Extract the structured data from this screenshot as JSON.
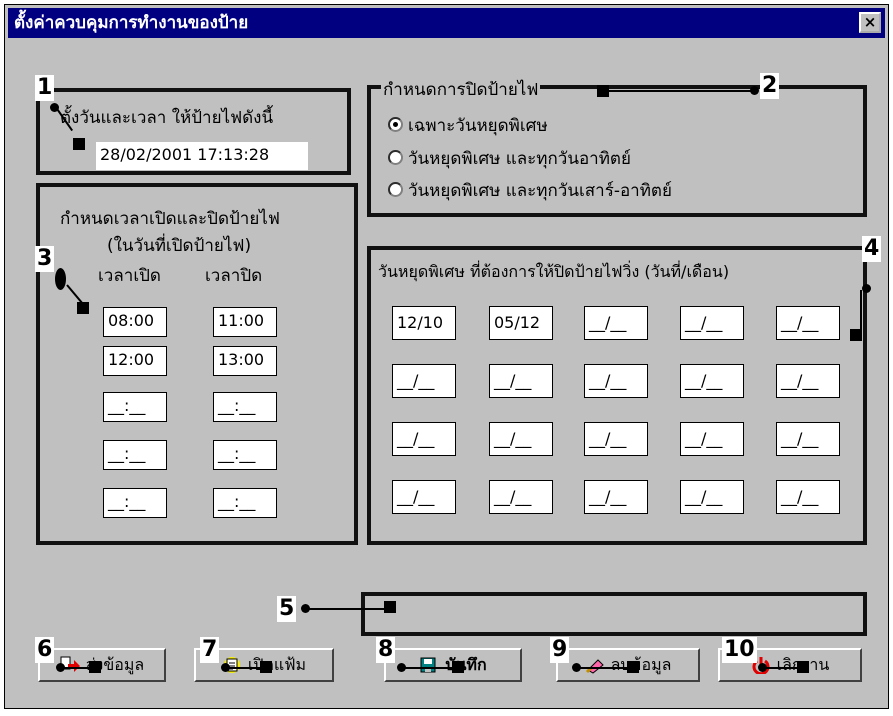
{
  "window": {
    "title": "ตั้งค่าควบคุมการทำงานของป้าย",
    "close_glyph": "×"
  },
  "datetime_group": {
    "label": "ตั้งวันและเวลา ให้ป้ายไฟดังนี้",
    "value": "28/02/2001  17:13:28"
  },
  "close_mode_group": {
    "legend": "กำหนดการปิดป้ายไฟ",
    "options": [
      {
        "label": "เฉพาะวันหยุดพิเศษ",
        "selected": true
      },
      {
        "label": "วันหยุดพิเศษ และทุกวันอาทิตย์",
        "selected": false
      },
      {
        "label": "วันหยุดพิเศษ และทุกวันเสาร์-อาทิตย์",
        "selected": false
      }
    ]
  },
  "time_group": {
    "heading_line1": "กำหนดเวลาเปิดและปิดป้ายไฟ",
    "heading_line2": "(ในวันที่เปิดป้ายไฟ)",
    "open_header": "เวลาเปิด",
    "close_header": "เวลาปิด",
    "rows": [
      {
        "open": "08:00",
        "close": "11:00"
      },
      {
        "open": "12:00",
        "close": "13:00"
      },
      {
        "open": "__:__",
        "close": "__:__"
      },
      {
        "open": "__:__",
        "close": "__:__"
      },
      {
        "open": "__:__",
        "close": "__:__"
      }
    ]
  },
  "holiday_group": {
    "heading": "วันหยุดพิเศษ ที่ต้องการให้ปิดป้ายไฟวิ่ง (วันที่/เดือน)",
    "dates": [
      "12/10",
      "05/12",
      "__/__",
      "__/__",
      "__/__",
      "__/__",
      "__/__",
      "__/__",
      "__/__",
      "__/__",
      "__/__",
      "__/__",
      "__/__",
      "__/__",
      "__/__",
      "__/__",
      "__/__",
      "__/__",
      "__/__",
      "__/__"
    ]
  },
  "status_bar": {
    "text": ""
  },
  "buttons": {
    "send": {
      "label": "ส่งข้อมูล",
      "icon": "send-data-icon"
    },
    "open": {
      "label": "เปิดแฟ้ม",
      "icon": "open-file-icon"
    },
    "save": {
      "label": "บันทึก",
      "icon": "save-icon"
    },
    "delete": {
      "label": "ลบข้อมูล",
      "icon": "eraser-icon"
    },
    "exit": {
      "label": "เลิกงาน",
      "icon": "power-icon"
    }
  },
  "callouts": [
    "1",
    "2",
    "3",
    "4",
    "5",
    "6",
    "7",
    "8",
    "9",
    "10"
  ]
}
